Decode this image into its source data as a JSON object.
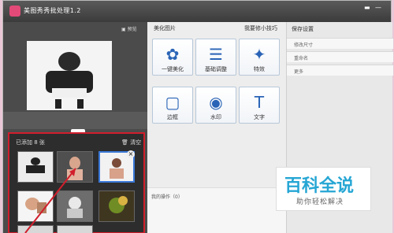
{
  "app": {
    "title": "美图秀秀批处理1.2"
  },
  "left": {
    "preview_label": "预览",
    "added_label": "已添加 8 张",
    "clear_label": "清空"
  },
  "main": {
    "section_title": "美化图片",
    "help_link": "我要修小技巧",
    "tools": [
      {
        "label": "一键美化",
        "icon": "flower-icon"
      },
      {
        "label": "基础调整",
        "icon": "sliders-icon"
      },
      {
        "label": "特效",
        "icon": "magic-wand-icon"
      },
      {
        "label": "边框",
        "icon": "frame-icon"
      },
      {
        "label": "水印",
        "icon": "watermark-icon"
      },
      {
        "label": "文字",
        "icon": "text-icon"
      }
    ],
    "ops_title": "我的操作（0）"
  },
  "right": {
    "title": "保存设置",
    "items": [
      {
        "label": "修改尺寸"
      },
      {
        "label": "重命名"
      },
      {
        "label": "更多"
      }
    ]
  },
  "watermark": {
    "main": "百科全说",
    "sub": "助你轻松解决"
  }
}
